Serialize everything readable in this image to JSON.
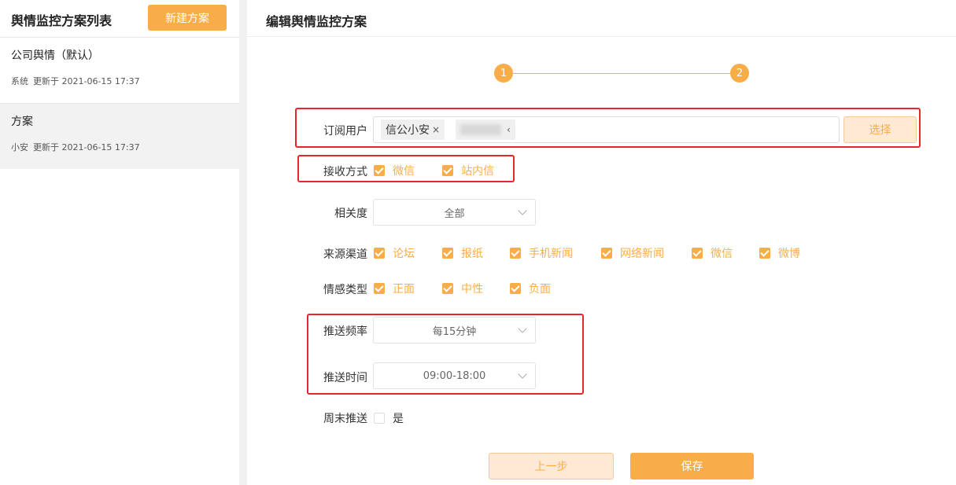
{
  "sidebar": {
    "title": "舆情监控方案列表",
    "new_button": "新建方案",
    "plans": [
      {
        "name": "公司舆情（默认）",
        "creator": "系统",
        "updated": "更新于 2021-06-15 17:37"
      },
      {
        "name": "方案",
        "creator": "小安",
        "updated": "更新于 2021-06-15 17:37"
      }
    ]
  },
  "main": {
    "title": "编辑舆情监控方案",
    "steps": [
      "1",
      "2"
    ]
  },
  "form": {
    "subscribers": {
      "label": "订阅用户",
      "tags": [
        "信公小安",
        ""
      ],
      "tag_remove_glyph": "×",
      "tag_remove_glyph_small": "‹",
      "select_button": "选择"
    },
    "receive": {
      "label": "接收方式",
      "options": [
        "微信",
        "站内信"
      ]
    },
    "relevance": {
      "label": "相关度",
      "value": "全部"
    },
    "source": {
      "label": "来源渠道",
      "options": [
        "论坛",
        "报纸",
        "手机新闻",
        "网络新闻",
        "微信",
        "微博"
      ]
    },
    "sentiment": {
      "label": "情感类型",
      "options": [
        "正面",
        "中性",
        "负面"
      ]
    },
    "frequency": {
      "label": "推送频率",
      "value": "每15分钟"
    },
    "time": {
      "label": "推送时间",
      "value": "09:00-18:00"
    },
    "weekend": {
      "label": "周末推送",
      "option": "是"
    }
  },
  "buttons": {
    "prev": "上一步",
    "save": "保存"
  },
  "colors": {
    "accent": "#f9ad48",
    "accent_light": "#fde9d4",
    "highlight": "#e5262a"
  }
}
